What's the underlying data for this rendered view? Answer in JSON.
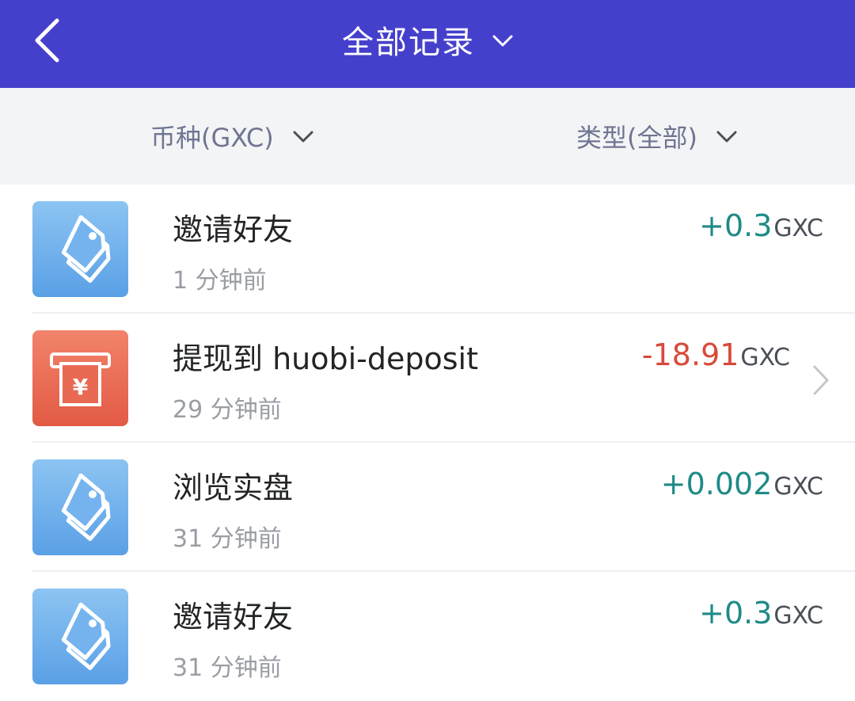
{
  "header": {
    "title": "全部记录",
    "bg_color": "#4540cc"
  },
  "filters": {
    "coin_label": "币种(GXC)",
    "type_label": "类型(全部)"
  },
  "records": [
    {
      "icon": "tag-icon",
      "title": "邀请好友",
      "time": "1 分钟前",
      "amount": "+0.3",
      "unit": "GXC",
      "amount_color": "#1e8a87"
    },
    {
      "icon": "withdraw-yuan-icon",
      "title": "提现到 huobi-deposit",
      "time": "29 分钟前",
      "amount": "-18.91",
      "unit": "GXC",
      "amount_color": "#d94a3a"
    },
    {
      "icon": "tag-icon",
      "title": "浏览实盘",
      "time": "31 分钟前",
      "amount": "+0.002",
      "unit": "GXC",
      "amount_color": "#1e8a87"
    },
    {
      "icon": "tag-icon",
      "title": "邀请好友",
      "time": "31 分钟前",
      "amount": "+0.3",
      "unit": "GXC",
      "amount_color": "#1e8a87"
    }
  ]
}
